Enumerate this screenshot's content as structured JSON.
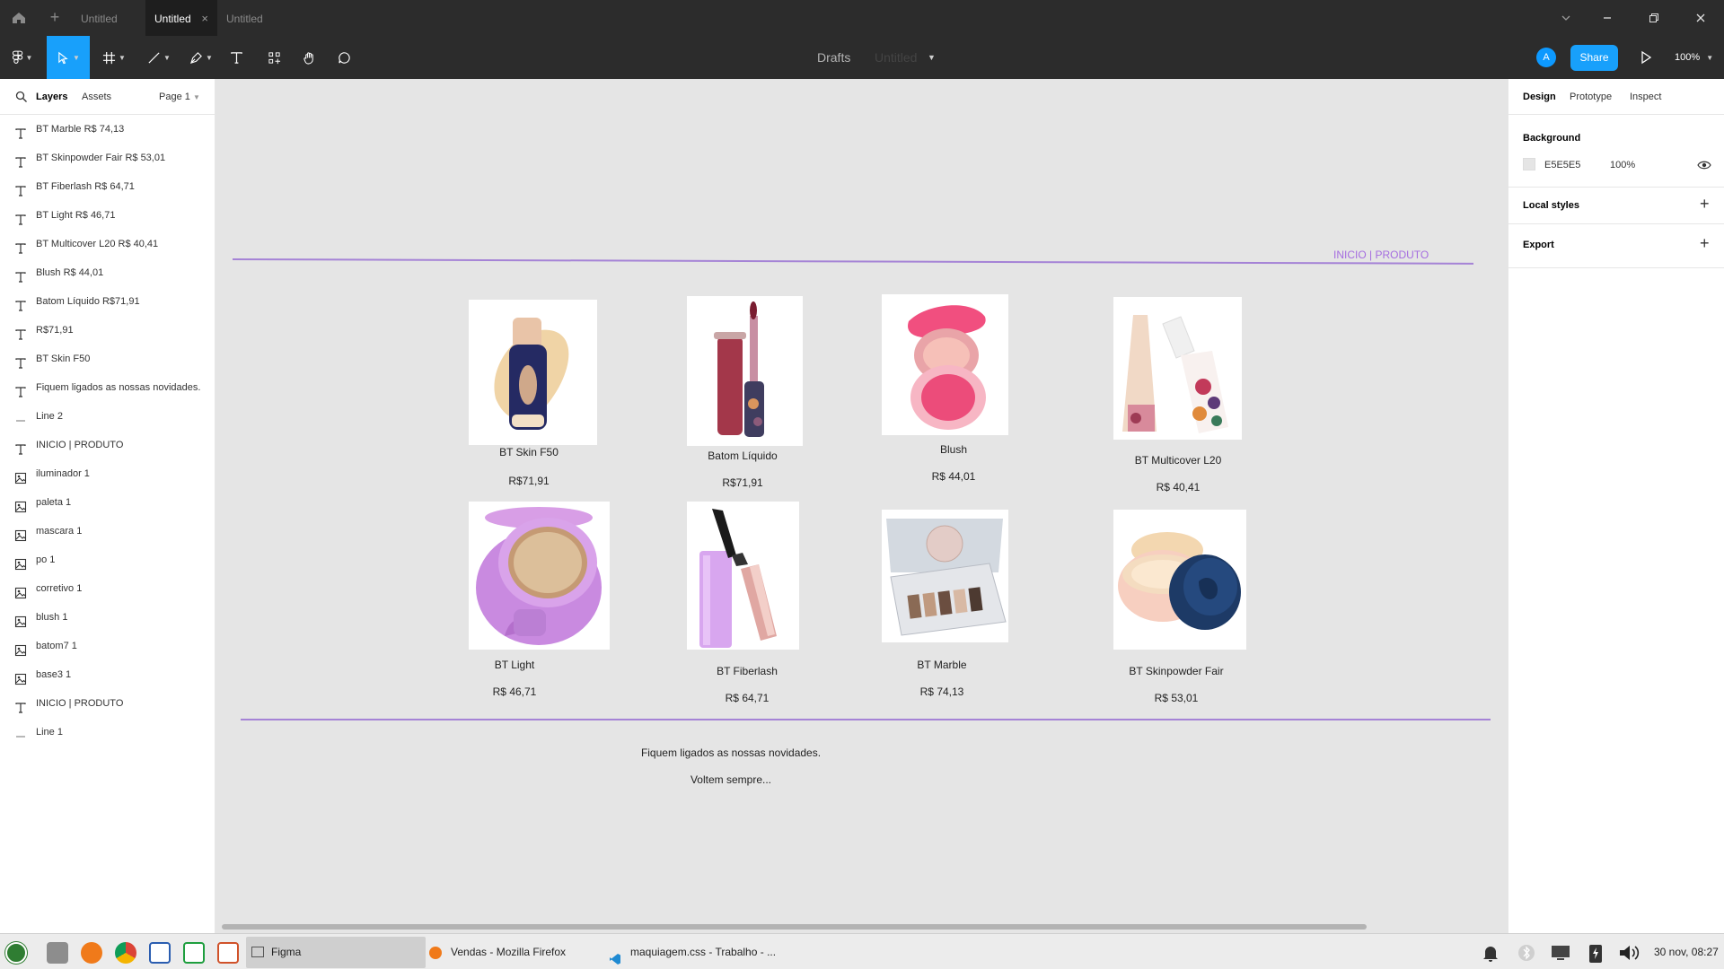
{
  "tabs": {
    "items": [
      {
        "label": "Untitled",
        "active": false
      },
      {
        "label": "Untitled",
        "active": true
      },
      {
        "label": "Untitled",
        "active": false
      }
    ],
    "close_glyph": "×"
  },
  "toolbar": {
    "breadcrumb_folder": "Drafts",
    "file_name": "Untitled",
    "avatar_letter": "A",
    "share_label": "Share",
    "zoom": "100%"
  },
  "left_panel": {
    "tabs": [
      "Layers",
      "Assets"
    ],
    "page": "Page 1",
    "layers": [
      {
        "icon": "text-layer-icon",
        "name": "BT Marble R$ 74,13"
      },
      {
        "icon": "text-layer-icon",
        "name": "BT Skinpowder Fair R$ 53,01"
      },
      {
        "icon": "text-layer-icon",
        "name": "BT Fiberlash R$ 64,71"
      },
      {
        "icon": "text-layer-icon",
        "name": "BT Light R$ 46,71"
      },
      {
        "icon": "text-layer-icon",
        "name": "BT Multicover L20 R$ 40,41"
      },
      {
        "icon": "text-layer-icon",
        "name": "Blush R$ 44,01"
      },
      {
        "icon": "text-layer-icon",
        "name": "Batom Líquido R$71,91"
      },
      {
        "icon": "text-layer-icon",
        "name": "R$71,91"
      },
      {
        "icon": "text-layer-icon",
        "name": "BT Skin F50"
      },
      {
        "icon": "text-layer-icon",
        "name": "Fiquem ligados as nossas novidades."
      },
      {
        "icon": "line-layer-icon",
        "name": "Line 2"
      },
      {
        "icon": "text-layer-icon",
        "name": "INICIO | PRODUTO"
      },
      {
        "icon": "image-layer-icon",
        "name": "iluminador 1"
      },
      {
        "icon": "image-layer-icon",
        "name": "paleta 1"
      },
      {
        "icon": "image-layer-icon",
        "name": "mascara 1"
      },
      {
        "icon": "image-layer-icon",
        "name": "po 1"
      },
      {
        "icon": "image-layer-icon",
        "name": "corretivo 1"
      },
      {
        "icon": "image-layer-icon",
        "name": "blush 1"
      },
      {
        "icon": "image-layer-icon",
        "name": "batom7 1"
      },
      {
        "icon": "image-layer-icon",
        "name": "base3 1"
      },
      {
        "icon": "text-layer-icon",
        "name": "INICIO | PRODUTO"
      },
      {
        "icon": "line-layer-icon",
        "name": "Line 1"
      }
    ]
  },
  "canvas": {
    "nav_text": "INICIO | PRODUTO",
    "products": [
      {
        "name": "BT Skin F50",
        "price": "R$71,91",
        "image": "foundation-bottle"
      },
      {
        "name": "Batom Líquido",
        "price": "R$71,91",
        "image": "liquid-lipstick"
      },
      {
        "name": "Blush",
        "price": "R$ 44,01",
        "image": "blush-compact"
      },
      {
        "name": "BT Multicover L20",
        "price": "R$ 40,41",
        "image": "concealer-tube"
      },
      {
        "name": "BT Light",
        "price": "R$ 46,71",
        "image": "highlighter-compact"
      },
      {
        "name": "BT Fiberlash",
        "price": "R$ 64,71",
        "image": "mascara"
      },
      {
        "name": "BT Marble",
        "price": "R$ 74,13",
        "image": "eyeshadow-palette"
      },
      {
        "name": "BT Skinpowder Fair",
        "price": "R$ 53,01",
        "image": "loose-powder"
      }
    ],
    "footer_line1": "Fiquem ligados as nossas novidades.",
    "footer_line2": "Voltem sempre...",
    "help_label": "?"
  },
  "right_panel": {
    "tabs": [
      "Design",
      "Prototype",
      "Inspect"
    ],
    "background_title": "Background",
    "background_hex": "E5E5E5",
    "background_opacity": "100%",
    "background_color": "#e5e5e5",
    "local_styles": "Local styles",
    "export": "Export"
  },
  "taskbar": {
    "apps": [
      {
        "label": "Figma",
        "active": true
      },
      {
        "label": "Vendas - Mozilla Firefox",
        "active": false
      },
      {
        "label": "maquiagem.css - Trabalho - ...",
        "active": false
      }
    ],
    "clock": "30 nov, 08:27"
  },
  "colors": {
    "accent": "#18a0fb",
    "chrome_dark": "#2c2c2c",
    "line_purple": "#a583d6",
    "nav_purple": "#a56de0"
  }
}
